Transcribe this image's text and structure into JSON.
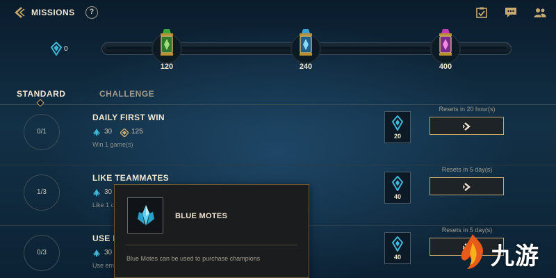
{
  "header": {
    "title": "MISSIONS",
    "help_label": "?"
  },
  "progress": {
    "blue_motes": "0",
    "milestones": [
      {
        "label": "120",
        "color": "#3a8a3a"
      },
      {
        "label": "240",
        "color": "#3aa0d8"
      },
      {
        "label": "400",
        "color": "#c23ab8"
      }
    ]
  },
  "tabs": [
    {
      "label": "STANDARD",
      "active": true
    },
    {
      "label": "CHALLENGE",
      "active": false
    }
  ],
  "missions": [
    {
      "progress": "0/1",
      "title": "DAILY FIRST WIN",
      "motes": "30",
      "essence": "125",
      "desc": "Win 1 game(s)",
      "reward": "20",
      "reset": "Resets in 20 hour(s)"
    },
    {
      "progress": "1/3",
      "title": "LIKE TEAMMATES",
      "motes": "30",
      "essence": "",
      "desc": "Like 1 c",
      "reward": "40",
      "reset": "Resets in 5 day(s)"
    },
    {
      "progress": "0/3",
      "title": "USE EMOTES",
      "motes": "30",
      "essence": "",
      "desc": "Use em",
      "reward": "40",
      "reset": "Resets in 5 day(s)"
    }
  ],
  "tooltip": {
    "title": "BLUE MOTES",
    "description": "Blue Motes can be used to purchase champions"
  },
  "watermark": {
    "text": "九游"
  },
  "colors": {
    "gold": "#c8aa6e",
    "text_light": "#f0e6d2",
    "mote_blue": "#3fb8d8"
  }
}
